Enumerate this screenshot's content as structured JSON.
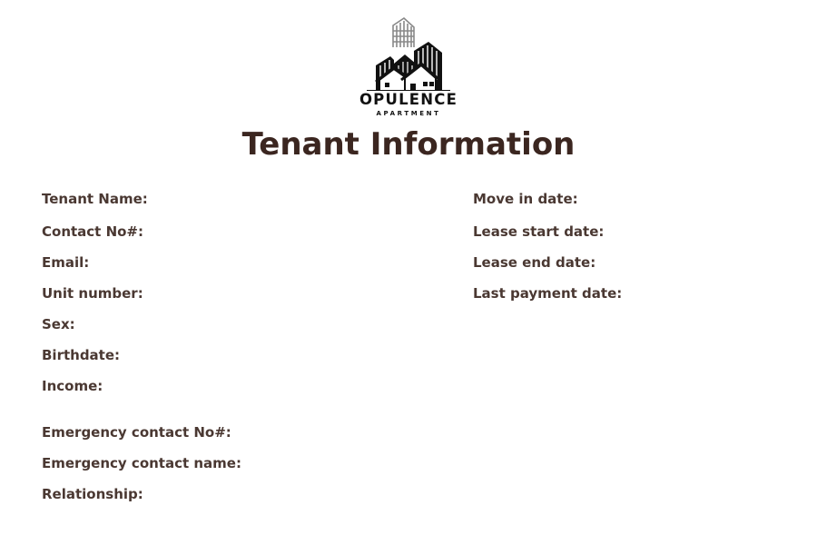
{
  "brand": {
    "name": "OPULENCE",
    "subtitle": "APARTMENT",
    "logo_icon": "apartment-buildings-logo"
  },
  "title": "Tenant Information",
  "left_fields": [
    "Tenant Name:",
    "Contact No#:",
    "Email:",
    "Unit number:",
    "Sex:",
    "Birthdate:",
    "Income:"
  ],
  "emergency_fields": [
    "Emergency contact No#:",
    "Emergency contact name:",
    "Relationship:"
  ],
  "right_fields": [
    "Move in date:",
    "Lease start date:",
    "Lease end date:",
    "Last payment date:"
  ],
  "colors": {
    "title": "#3b2620",
    "label": "#4a3832",
    "logo": "#111111"
  }
}
